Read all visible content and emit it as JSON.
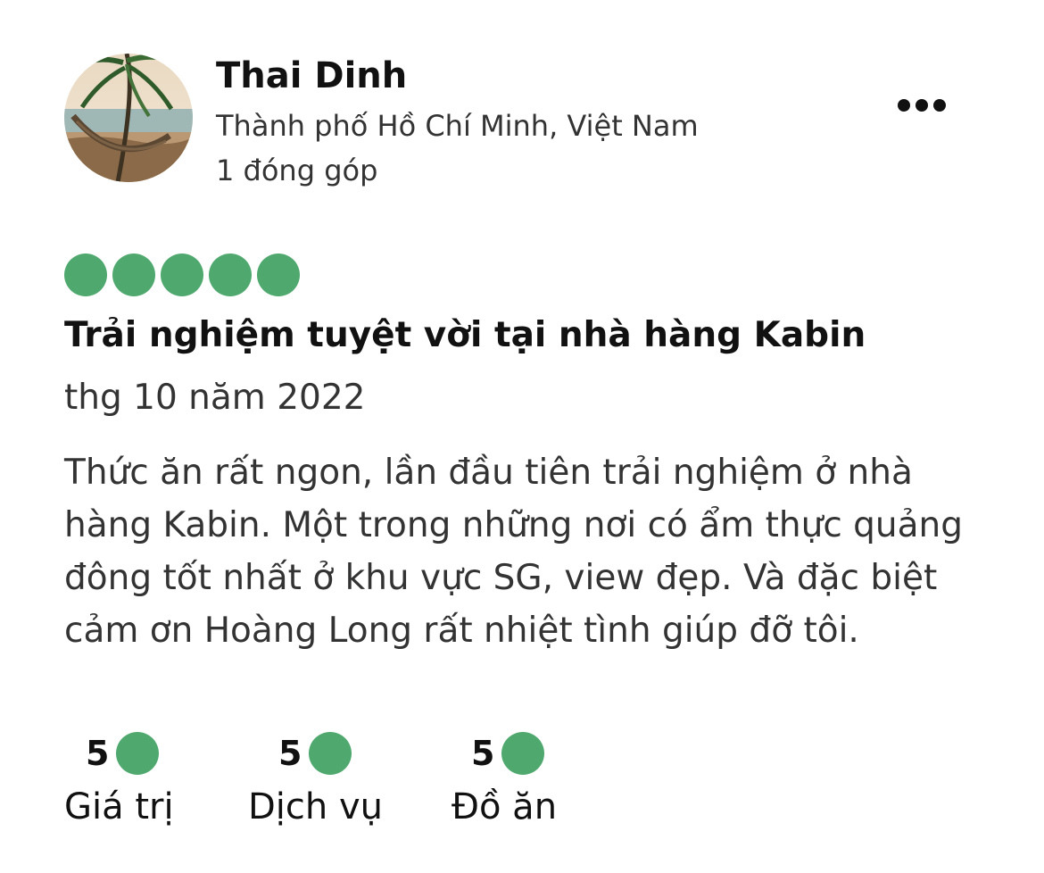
{
  "user": {
    "name": "Thai Dinh",
    "location": "Thành phố Hồ Chí Minh, Việt Nam",
    "contributions": "1 đóng góp",
    "avatar_icon": "beach-hammock-photo"
  },
  "more_icon": "more-horizontal-icon",
  "review": {
    "rating": 5,
    "rating_max": 5,
    "title": "Trải nghiệm tuyệt vời tại nhà hàng Kabin",
    "date": "thg 10 năm 2022",
    "body": "Thức ăn rất ngon, lần đầu tiên trải nghiệm ở nhà hàng Kabin. Một trong những nơi có ẩm thực quảng đông tốt nhất ở khu vực SG, view đẹp. Và đặc biệt cảm ơn Hoàng Long rất nhiệt tình giúp đỡ tôi."
  },
  "subratings": [
    {
      "score": "5",
      "label": "Giá trị"
    },
    {
      "score": "5",
      "label": "Dịch vụ"
    },
    {
      "score": "5",
      "label": "Đồ ăn"
    }
  ],
  "colors": {
    "bubble_fill": "#4fa96f",
    "text_primary": "#111111",
    "text_secondary": "#333333"
  }
}
